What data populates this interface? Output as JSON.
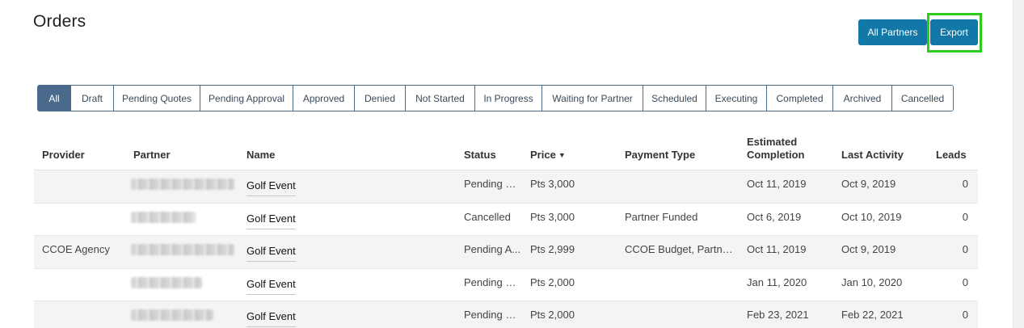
{
  "header": {
    "title": "Orders",
    "all_partners_label": "All Partners",
    "export_label": "Export"
  },
  "filters": [
    {
      "label": "All",
      "active": true
    },
    {
      "label": "Draft"
    },
    {
      "label": "Pending Quotes"
    },
    {
      "label": "Pending Approval"
    },
    {
      "label": "Approved"
    },
    {
      "label": "Denied"
    },
    {
      "label": "Not Started"
    },
    {
      "label": "In Progress"
    },
    {
      "label": "Waiting for Partner"
    },
    {
      "label": "Scheduled"
    },
    {
      "label": "Executing"
    },
    {
      "label": "Completed"
    },
    {
      "label": "Archived"
    },
    {
      "label": "Cancelled"
    }
  ],
  "table": {
    "columns": {
      "provider": "Provider",
      "partner": "Partner",
      "name": "Name",
      "status": "Status",
      "price": "Price",
      "price_sort_icon": "caret-down-icon",
      "payment_type": "Payment Type",
      "estimated_line1": "Estimated",
      "estimated_line2": "Completion",
      "last_activity": "Last Activity",
      "leads": "Leads"
    },
    "rows": [
      {
        "provider": "",
        "name": "Golf Event",
        "status": "Pending Q...",
        "price": "Pts 3,000",
        "payment_type": "",
        "estimated": "Oct 11, 2019",
        "last_activity": "Oct 9, 2019",
        "leads": "0"
      },
      {
        "provider": "",
        "name": "Golf Event",
        "status": "Cancelled",
        "price": "Pts 3,000",
        "payment_type": "Partner Funded",
        "estimated": "Oct 6, 2019",
        "last_activity": "Oct 10, 2019",
        "leads": "0"
      },
      {
        "provider": "CCOE Agency",
        "name": "Golf Event",
        "status": "Pending A...",
        "price": "Pts 2,999",
        "payment_type": "CCOE Budget, Partner ...",
        "estimated": "Oct 11, 2019",
        "last_activity": "Oct 9, 2019",
        "leads": "0"
      },
      {
        "provider": "",
        "name": "Golf Event",
        "status": "Pending Q...",
        "price": "Pts 2,000",
        "payment_type": "",
        "estimated": "Jan 11, 2020",
        "last_activity": "Jan 10, 2020",
        "leads": "0"
      },
      {
        "provider": "",
        "name": "Golf Event",
        "status": "Pending Q...",
        "price": "Pts 2,000",
        "payment_type": "",
        "estimated": "Feb 23, 2021",
        "last_activity": "Feb 22, 2021",
        "leads": "0"
      }
    ]
  },
  "colors": {
    "primary_button": "#1278a8",
    "filter_active": "#4a6a8c",
    "highlight_box": "#2ecc1a"
  }
}
